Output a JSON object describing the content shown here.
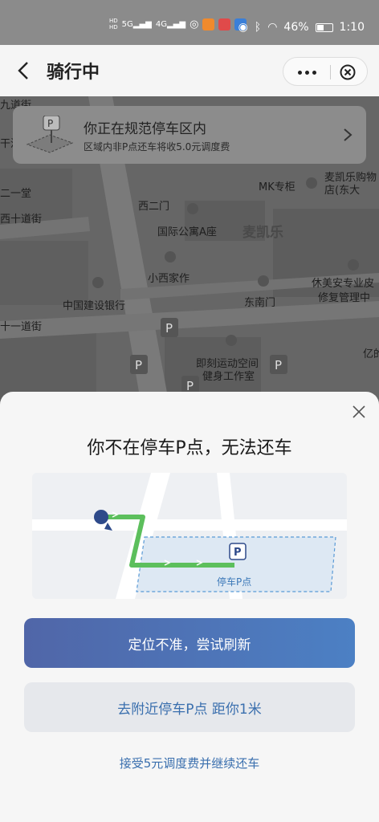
{
  "status_bar": {
    "sim1": "HD",
    "sim2": "HD",
    "network1": "5G",
    "network2": "4G",
    "battery": "46%",
    "time": "1:10"
  },
  "header": {
    "title": "骑行中"
  },
  "zone_banner": {
    "title": "你正在规范停车区内",
    "subtitle": "区域内非P点还车将收5.0元调度费"
  },
  "map": {
    "labels": [
      "九道街",
      "干沿",
      "二一堂",
      "西十道街",
      "十一道街",
      "西二门",
      "国际公寓A座",
      "麦凯乐",
      "MK专柜",
      "麦凯乐购物",
      "店(东大",
      "小西家作",
      "中国建设银行",
      "东南门",
      "休美安专业皮",
      "修复管理中",
      "即刻运动空间",
      "健身工作室",
      "亿的"
    ]
  },
  "sheet": {
    "title": "你不在停车P点，无法还车",
    "parking_label": "停车P点",
    "primary_button": "定位不准，尝试刷新",
    "secondary_button": "去附近停车P点 距你1米",
    "accept_link": "接受5元调度费并继续还车"
  },
  "colors": {
    "primary_gradient_start": "#5066a8",
    "primary_gradient_end": "#4c80c4",
    "link_blue": "#3a6fae",
    "route_green": "#5cbf5c"
  }
}
